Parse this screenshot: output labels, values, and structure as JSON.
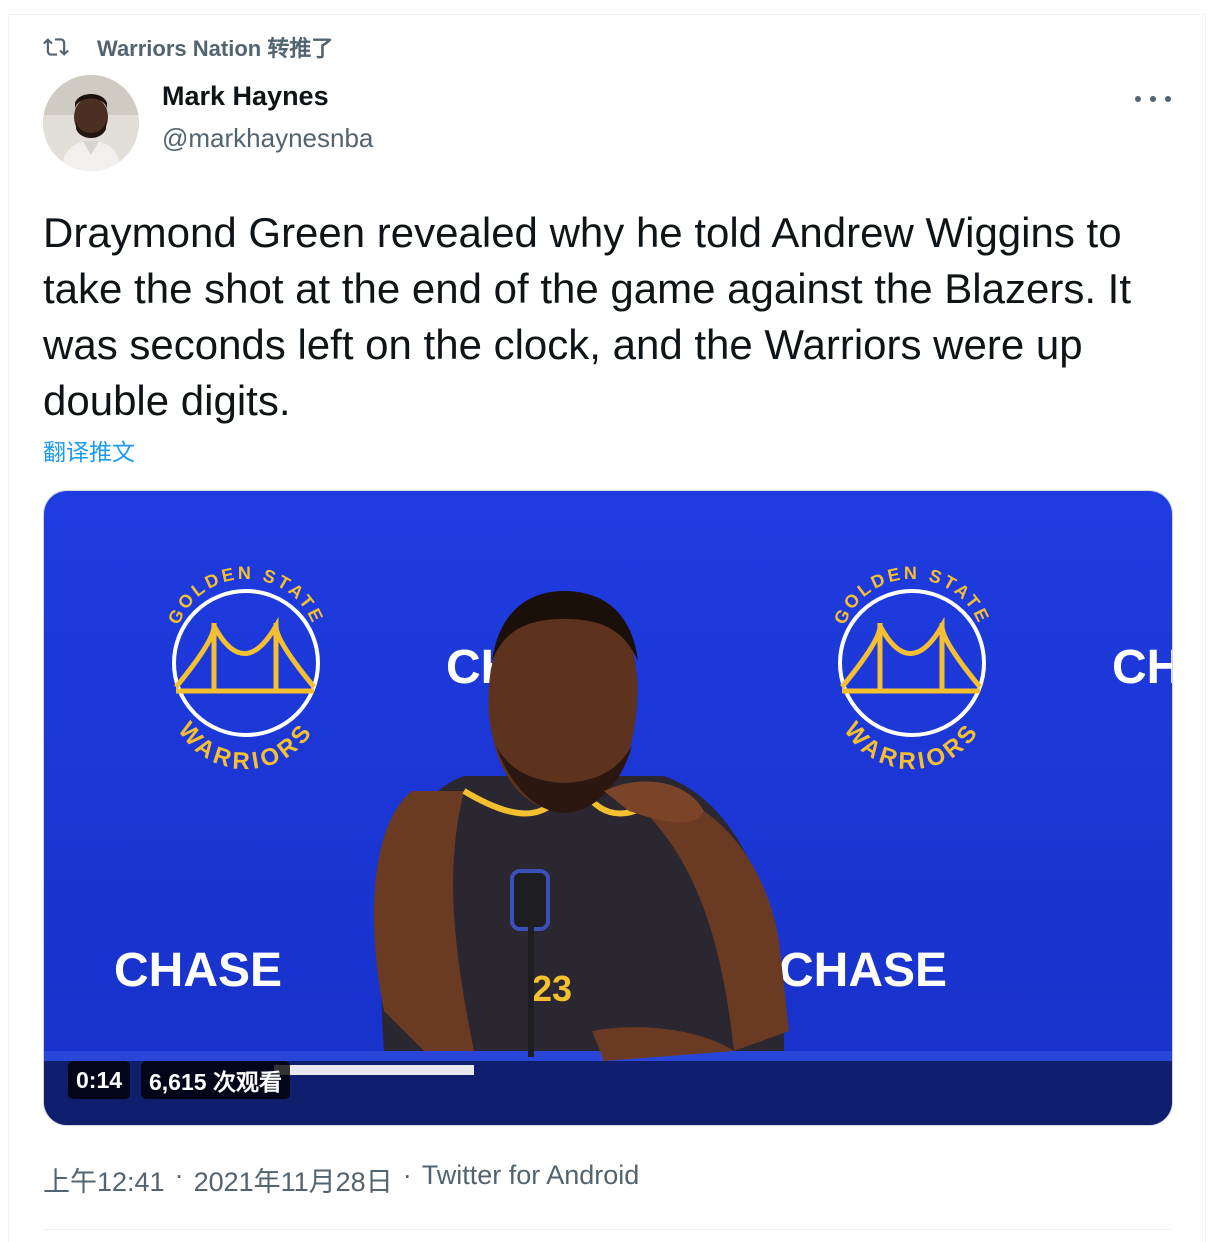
{
  "retweet": {
    "text": "Warriors Nation 转推了"
  },
  "author": {
    "name": "Mark Haynes",
    "handle": "@markhaynesnba"
  },
  "tweet": {
    "text": "Draymond Green revealed why he told Andrew Wiggins to take the shot at the end of the game against the Blazers. It was seconds left on the clock, and the Warriors were up double digits.",
    "translate_label": "翻译推文"
  },
  "media": {
    "duration": "0:14",
    "views": "6,615 次观看",
    "backdrop_sponsor": "CHASE",
    "logo_top_text": "GOLDEN STATE",
    "logo_bottom_text": "WARRIORS",
    "jersey_number": "23",
    "colors": {
      "backdrop": "#1a34d6",
      "logo_gold": "#f5c030",
      "jersey": "#2a2730"
    }
  },
  "meta": {
    "time": "上午12:41",
    "separator": "·",
    "date": "2021年11月28日",
    "source": "Twitter for Android"
  },
  "icons": {
    "retweet": "retweet-icon",
    "more": "more-icon"
  }
}
